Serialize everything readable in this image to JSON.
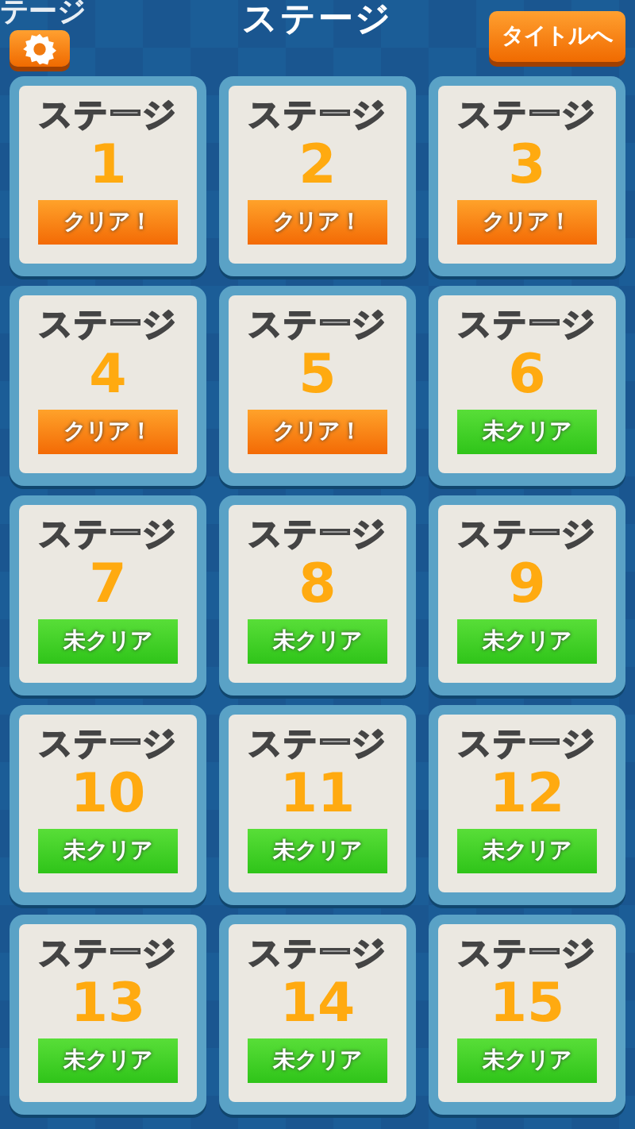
{
  "header": {
    "title": "ステージ",
    "prev_title": "テージ",
    "back_button": "タイトルへ"
  },
  "stages": [
    {
      "label": "ステージ",
      "number": "1",
      "status": "クリア！",
      "cleared": true
    },
    {
      "label": "ステージ",
      "number": "2",
      "status": "クリア！",
      "cleared": true
    },
    {
      "label": "ステージ",
      "number": "3",
      "status": "クリア！",
      "cleared": true
    },
    {
      "label": "ステージ",
      "number": "4",
      "status": "クリア！",
      "cleared": true
    },
    {
      "label": "ステージ",
      "number": "5",
      "status": "クリア！",
      "cleared": true
    },
    {
      "label": "ステージ",
      "number": "6",
      "status": "未クリア",
      "cleared": false
    },
    {
      "label": "ステージ",
      "number": "7",
      "status": "未クリア",
      "cleared": false
    },
    {
      "label": "ステージ",
      "number": "8",
      "status": "未クリア",
      "cleared": false
    },
    {
      "label": "ステージ",
      "number": "9",
      "status": "未クリア",
      "cleared": false
    },
    {
      "label": "ステージ",
      "number": "10",
      "status": "未クリア",
      "cleared": false
    },
    {
      "label": "ステージ",
      "number": "11",
      "status": "未クリア",
      "cleared": false
    },
    {
      "label": "ステージ",
      "number": "12",
      "status": "未クリア",
      "cleared": false
    },
    {
      "label": "ステージ",
      "number": "13",
      "status": "未クリア",
      "cleared": false
    },
    {
      "label": "ステージ",
      "number": "14",
      "status": "未クリア",
      "cleared": false
    },
    {
      "label": "ステージ",
      "number": "15",
      "status": "未クリア",
      "cleared": false
    }
  ]
}
